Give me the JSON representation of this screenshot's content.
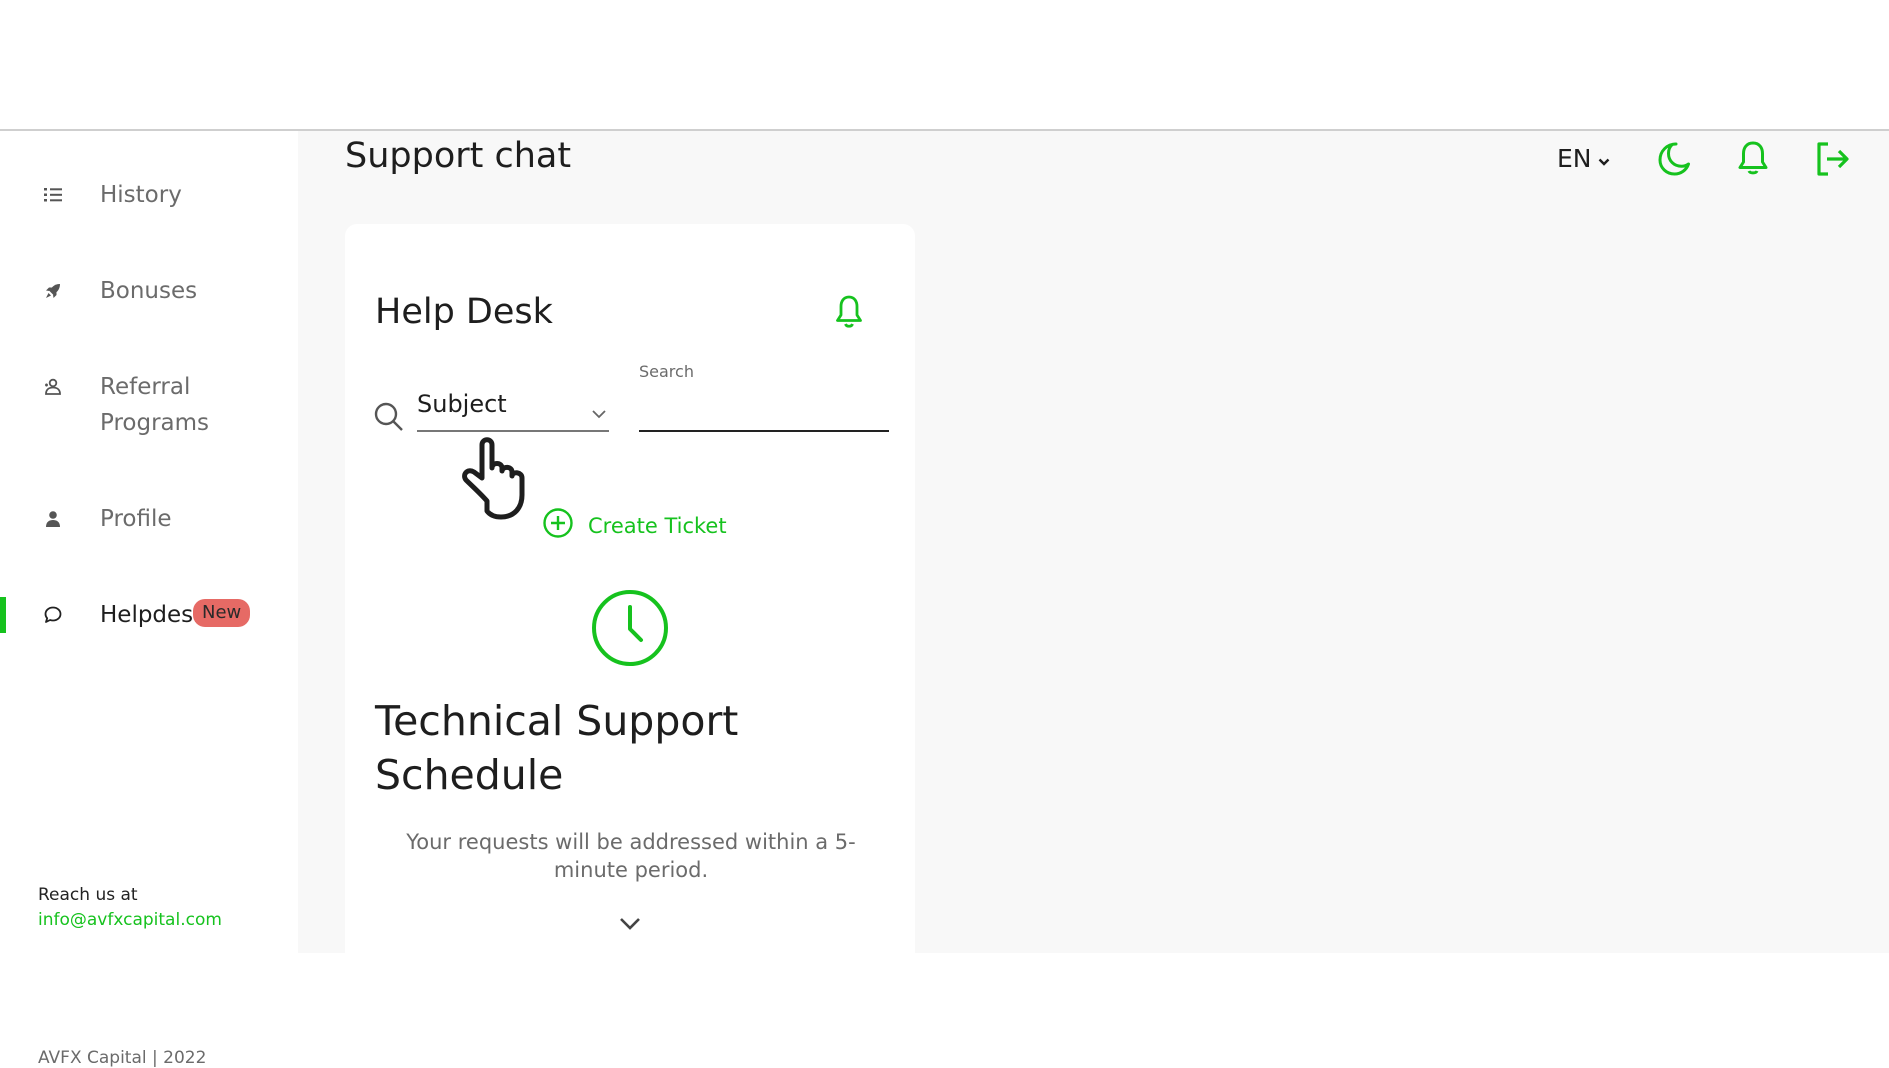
{
  "sidebar": {
    "items": [
      {
        "label": "History",
        "icon": "list-icon"
      },
      {
        "label": "Bonuses",
        "icon": "rocket-icon"
      },
      {
        "label": "Referral Programs",
        "icon": "referral-icon"
      },
      {
        "label": "Profile",
        "icon": "user-icon"
      },
      {
        "label": "Helpdesk",
        "icon": "chat-icon",
        "badge": "New",
        "active": true
      }
    ],
    "reach_label": "Reach us at",
    "reach_email": "info@avfxcapital.com",
    "footer": "AVFX Capital | 2022"
  },
  "header": {
    "title": "Support chat",
    "language": "EN",
    "icons": [
      "moon-icon",
      "bell-icon",
      "logout-icon"
    ]
  },
  "helpdesk": {
    "title": "Help Desk",
    "subject_value": "Subject",
    "search_label": "Search",
    "search_value": "",
    "create_ticket": "Create Ticket",
    "schedule_title": "Technical Support Schedule",
    "schedule_desc": "Your requests will be addressed within a 5-minute period."
  },
  "colors": {
    "accent": "#16c21e",
    "badge": "#e66a65",
    "main_bg": "#f8f8f8"
  }
}
